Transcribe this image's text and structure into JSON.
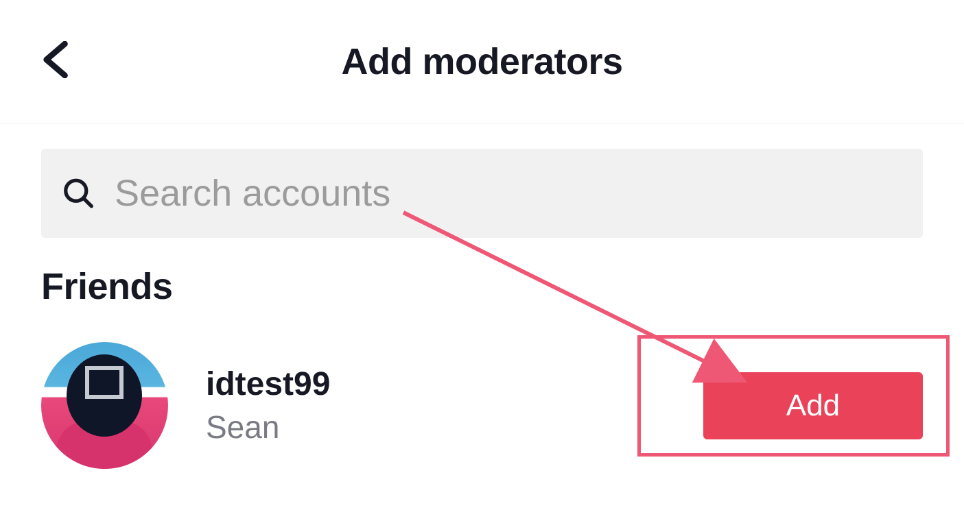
{
  "header": {
    "title": "Add moderators"
  },
  "search": {
    "placeholder": "Search accounts"
  },
  "section": {
    "title": "Friends"
  },
  "friends": [
    {
      "username": "idtest99",
      "display_name": "Sean",
      "button_label": "Add"
    }
  ],
  "colors": {
    "accent": "#ea4359",
    "annotation": "#ee5874"
  }
}
